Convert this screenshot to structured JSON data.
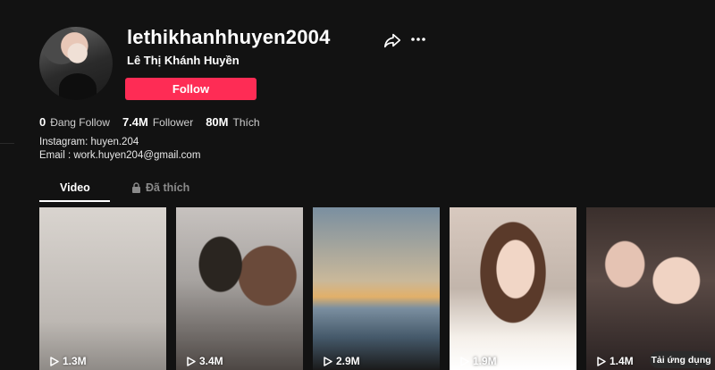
{
  "profile": {
    "username": "lethikhanhhuyen2004",
    "display_name": "Lê Thị Khánh Huyền",
    "follow_label": "Follow",
    "bio_lines": [
      "Instagram: huyen.204",
      "Email : work.huyen204@gmail.com"
    ]
  },
  "stats": [
    {
      "value": "0",
      "label": "Đang Follow"
    },
    {
      "value": "7.4M",
      "label": "Follower"
    },
    {
      "value": "80M",
      "label": "Thích"
    }
  ],
  "tabs": [
    {
      "label": "Video",
      "active": true
    },
    {
      "label": "Đã thích",
      "active": false,
      "icon": "lock-icon"
    }
  ],
  "videos": [
    {
      "views": "1.3M"
    },
    {
      "views": "3.4M"
    },
    {
      "views": "2.9M"
    },
    {
      "views": "1.9M"
    },
    {
      "views": "1.4M"
    }
  ],
  "app_button": "Tải ứng dụng",
  "colors": {
    "accent": "#fe2c55",
    "background": "#121212"
  }
}
